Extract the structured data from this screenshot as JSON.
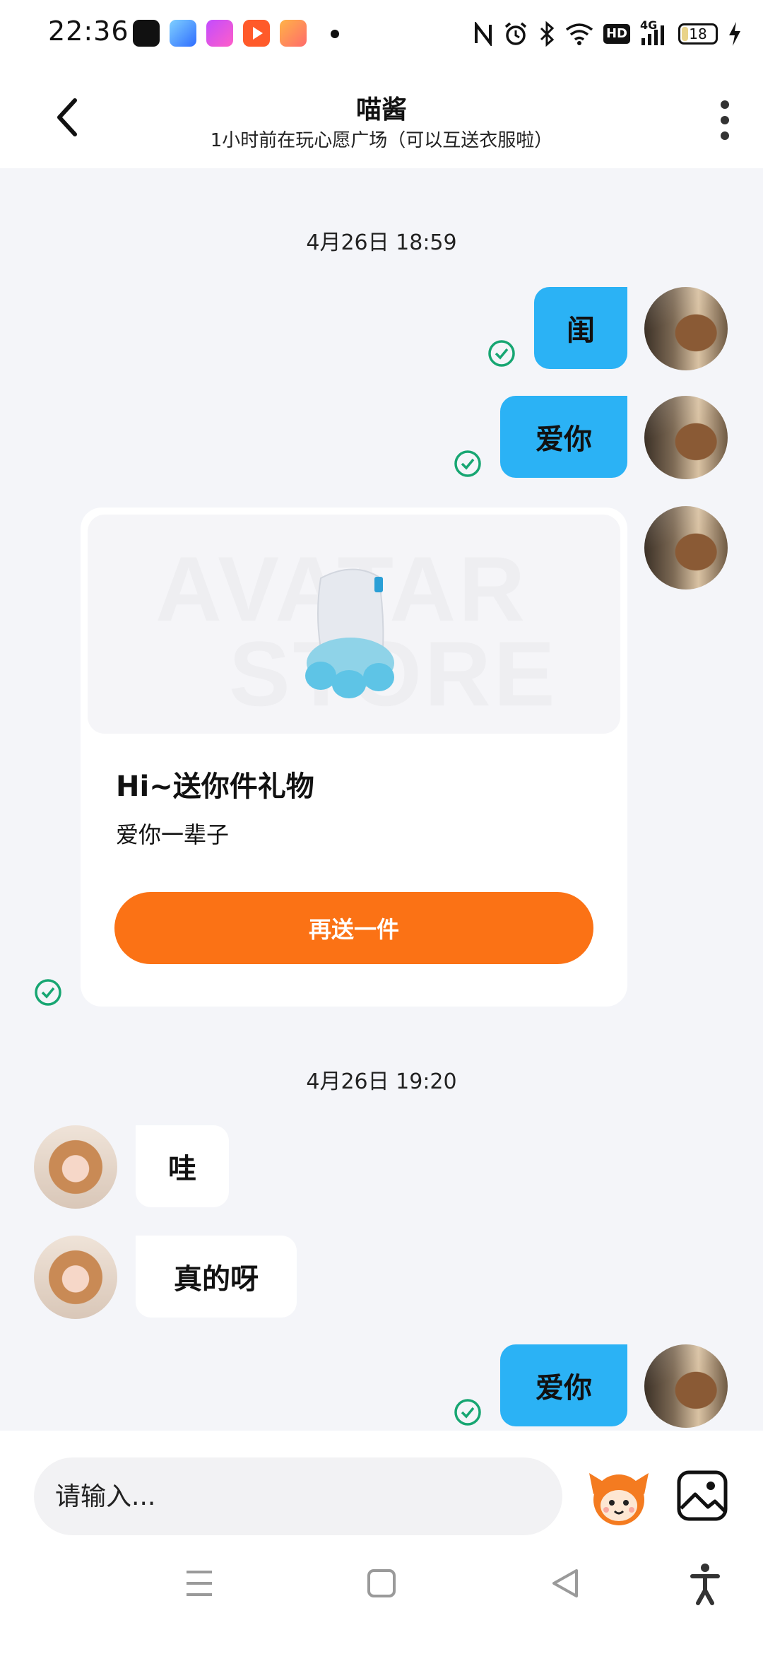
{
  "status_bar": {
    "time": "22:36",
    "battery": "18",
    "network": "4G",
    "hd_label": "HD",
    "icons": [
      "nfc-icon",
      "alarm-icon",
      "bluetooth-icon",
      "wifi-icon",
      "hd-icon",
      "signal-icon",
      "battery-icon",
      "charging-icon"
    ],
    "app_icons": [
      "dewu-app-icon",
      "blue-app-icon",
      "purple-app-icon",
      "video-app-icon",
      "game-app-icon"
    ]
  },
  "header": {
    "title": "喵酱",
    "subtitle": "1小时前在玩心愿广场（可以互送衣服啦）"
  },
  "messages": {
    "timestamp_1": "4月26日 18:59",
    "out_1": "闺",
    "out_2": "爱你",
    "gift": {
      "watermark_line1": "AVATAR",
      "watermark_line2": "STORE",
      "title": "Hi~送你件礼物",
      "description": "爱你一辈子",
      "button_label": "再送一件"
    },
    "timestamp_2": "4月26日 19:20",
    "in_1": "哇",
    "in_2": "真的呀",
    "out_3": "爱你"
  },
  "input": {
    "placeholder": "请输入..."
  },
  "colors": {
    "outgoing_bubble": "#2bb2f5",
    "gift_button": "#fb7215",
    "check": "#17a672",
    "background": "#f4f5f9"
  }
}
